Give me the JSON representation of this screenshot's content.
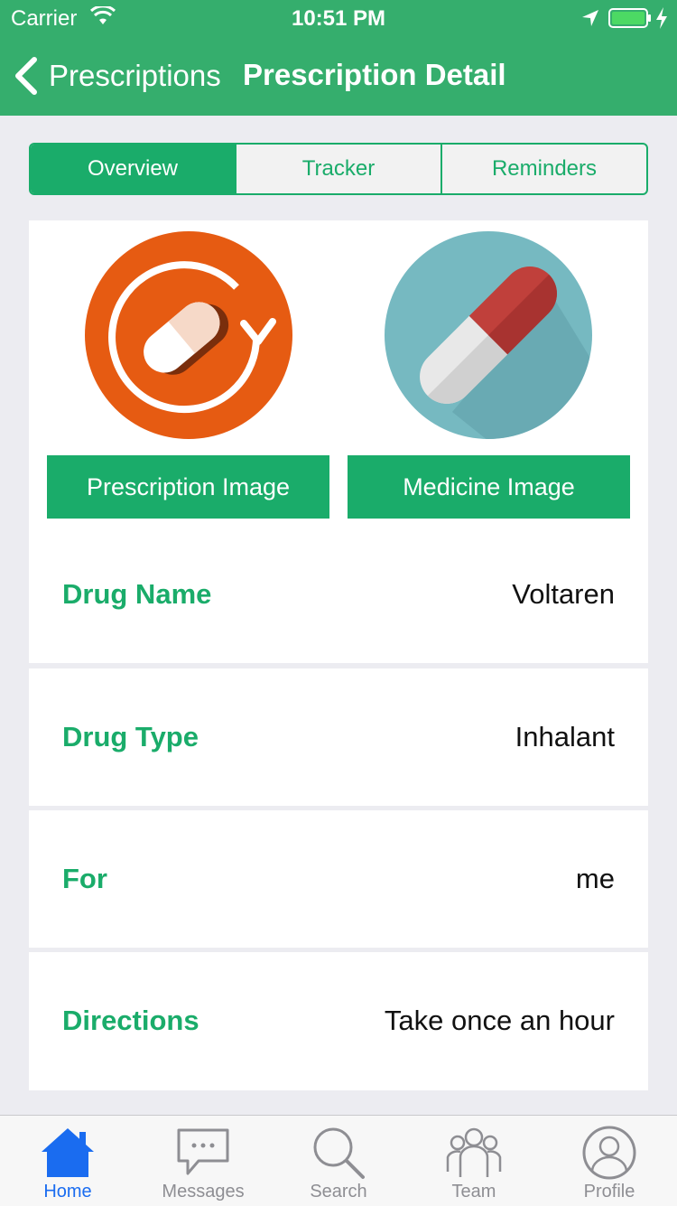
{
  "status_bar": {
    "carrier": "Carrier",
    "time": "10:51 PM"
  },
  "nav": {
    "back_label": "Prescriptions",
    "title": "Prescription Detail"
  },
  "segments": [
    {
      "label": "Overview",
      "active": true
    },
    {
      "label": "Tracker",
      "active": false
    },
    {
      "label": "Reminders",
      "active": false
    }
  ],
  "images": {
    "prescription_button": "Prescription Image",
    "medicine_button": "Medicine Image",
    "prescription_icon": "prescription-refill-icon",
    "medicine_icon": "capsule-icon"
  },
  "details": [
    {
      "label": "Drug Name",
      "value": "Voltaren"
    },
    {
      "label": "Drug Type",
      "value": "Inhalant"
    },
    {
      "label": "For",
      "value": "me"
    },
    {
      "label": "Directions",
      "value": "Take once an hour"
    }
  ],
  "tabs": [
    {
      "label": "Home",
      "icon": "home-icon",
      "active": true
    },
    {
      "label": "Messages",
      "icon": "chat-bubble-icon",
      "active": false
    },
    {
      "label": "Search",
      "icon": "search-icon",
      "active": false
    },
    {
      "label": "Team",
      "icon": "team-icon",
      "active": false
    },
    {
      "label": "Profile",
      "icon": "profile-icon",
      "active": false
    }
  ],
  "colors": {
    "nav_green": "#35ae6d",
    "accent_green": "#1aac6a",
    "active_tab_blue": "#1a6cf0",
    "orange": "#e65b12",
    "teal": "#76b9c1"
  }
}
